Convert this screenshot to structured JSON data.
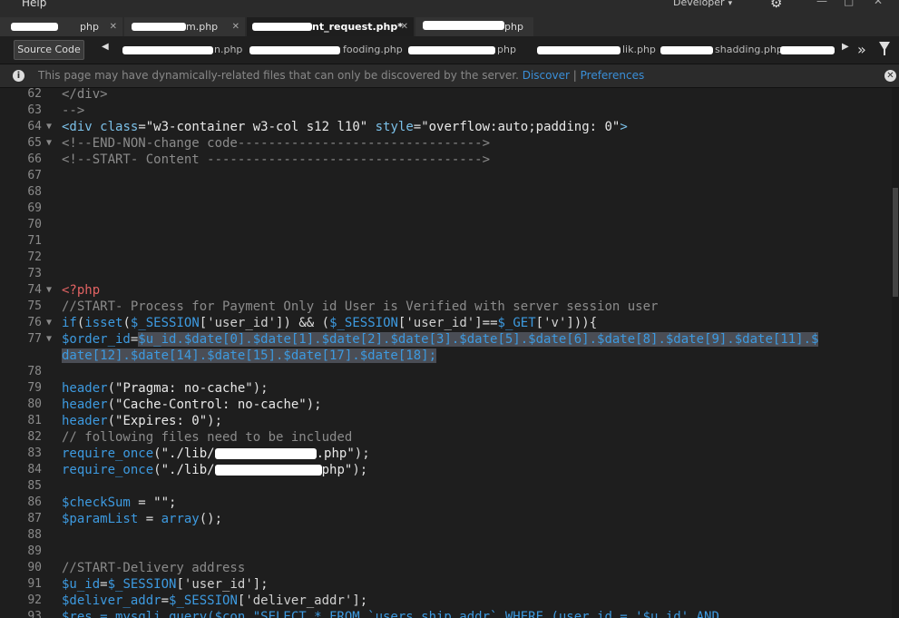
{
  "menu": {
    "help": "Help"
  },
  "workspace": {
    "label": "Developer"
  },
  "tabs": [
    {
      "label": "",
      "suffix": "php"
    },
    {
      "label": "",
      "suffix": "m.php"
    },
    {
      "label": "",
      "suffix": "nt_request.php*"
    },
    {
      "label": "",
      "suffix": "php"
    }
  ],
  "related": {
    "source_code": "Source Code",
    "files": [
      "n.php",
      "fooding.php",
      "php",
      "lik.php",
      "shadding.php",
      ""
    ]
  },
  "info": {
    "text": "This page may have dynamically-related files that can only be discovered by the server.",
    "discover": "Discover",
    "sep": "|",
    "preferences": "Preferences"
  },
  "code_lines": [
    {
      "n": "62",
      "fold": "",
      "parts": [
        {
          "t": "</div>",
          "c": "c-comm"
        }
      ]
    },
    {
      "n": "63",
      "fold": "",
      "parts": [
        {
          "t": "-->",
          "c": "c-comm"
        }
      ]
    },
    {
      "n": "64",
      "fold": "▼",
      "parts": [
        {
          "t": "<div ",
          "c": "c-tag"
        },
        {
          "t": "class",
          "c": "c-attr"
        },
        {
          "t": "=",
          "c": "c-pun"
        },
        {
          "t": "\"w3-container w3-col s12 l10\"",
          "c": "c-str"
        },
        {
          "t": " style",
          "c": "c-attr"
        },
        {
          "t": "=",
          "c": "c-pun"
        },
        {
          "t": "\"overflow:auto;padding: 0\"",
          "c": "c-str"
        },
        {
          "t": ">",
          "c": "c-tag"
        }
      ]
    },
    {
      "n": "65",
      "fold": "▼",
      "parts": [
        {
          "t": "<!--END-NON-change code-------------------------------->",
          "c": "c-comm"
        }
      ]
    },
    {
      "n": "66",
      "fold": "",
      "parts": [
        {
          "t": "<!--START- Content ------------------------------------>",
          "c": "c-comm"
        }
      ]
    },
    {
      "n": "67",
      "fold": "",
      "parts": []
    },
    {
      "n": "68",
      "fold": "",
      "parts": []
    },
    {
      "n": "69",
      "fold": "",
      "parts": []
    },
    {
      "n": "70",
      "fold": "",
      "parts": []
    },
    {
      "n": "71",
      "fold": "",
      "parts": []
    },
    {
      "n": "72",
      "fold": "",
      "parts": []
    },
    {
      "n": "73",
      "fold": "",
      "parts": []
    },
    {
      "n": "74",
      "fold": "▼",
      "parts": [
        {
          "t": "<?php",
          "c": "c-php"
        }
      ]
    },
    {
      "n": "75",
      "fold": "",
      "parts": [
        {
          "t": "//START- Process for Payment Only id User is Verified with server session user",
          "c": "c-comm"
        }
      ]
    },
    {
      "n": "76",
      "fold": "▼",
      "parts": [
        {
          "t": "if",
          "c": "c-func"
        },
        {
          "t": "(",
          "c": "c-pun"
        },
        {
          "t": "isset",
          "c": "c-func"
        },
        {
          "t": "(",
          "c": "c-pun"
        },
        {
          "t": "$_SESSION",
          "c": "c-var"
        },
        {
          "t": "[",
          "c": "c-pun"
        },
        {
          "t": "'user_id'",
          "c": "c-sstr"
        },
        {
          "t": "]) && (",
          "c": "c-pun"
        },
        {
          "t": "$_SESSION",
          "c": "c-var"
        },
        {
          "t": "[",
          "c": "c-pun"
        },
        {
          "t": "'user_id'",
          "c": "c-sstr"
        },
        {
          "t": "]==",
          "c": "c-pun"
        },
        {
          "t": "$_GET",
          "c": "c-var"
        },
        {
          "t": "[",
          "c": "c-pun"
        },
        {
          "t": "'v'",
          "c": "c-sstr"
        },
        {
          "t": "])){",
          "c": "c-pun"
        }
      ]
    },
    {
      "n": "77",
      "fold": "▼",
      "parts": [
        {
          "t": "$order_id",
          "c": "c-var"
        },
        {
          "t": "=",
          "c": "c-pun"
        },
        {
          "t": "$u_id.$date[0].$date[1].$date[2].$date[3].$date[5].$date[6].$date[8].$date[9].$date[11].$",
          "c": "c-var",
          "hl": true
        }
      ]
    },
    {
      "n": "",
      "fold": "",
      "parts": [
        {
          "t": "date[12].$date[14].$date[15].$date[17].$date[18];",
          "c": "c-var",
          "hl": true
        }
      ]
    },
    {
      "n": "78",
      "fold": "",
      "parts": []
    },
    {
      "n": "79",
      "fold": "",
      "parts": [
        {
          "t": "header",
          "c": "c-func"
        },
        {
          "t": "(",
          "c": "c-pun"
        },
        {
          "t": "\"Pragma: no-cache\"",
          "c": "c-str"
        },
        {
          "t": ");",
          "c": "c-pun"
        }
      ]
    },
    {
      "n": "80",
      "fold": "",
      "parts": [
        {
          "t": "header",
          "c": "c-func"
        },
        {
          "t": "(",
          "c": "c-pun"
        },
        {
          "t": "\"Cache-Control: no-cache\"",
          "c": "c-str"
        },
        {
          "t": ");",
          "c": "c-pun"
        }
      ]
    },
    {
      "n": "81",
      "fold": "",
      "parts": [
        {
          "t": "header",
          "c": "c-func"
        },
        {
          "t": "(",
          "c": "c-pun"
        },
        {
          "t": "\"Expires: 0\"",
          "c": "c-str"
        },
        {
          "t": ");",
          "c": "c-pun"
        }
      ]
    },
    {
      "n": "82",
      "fold": "",
      "parts": [
        {
          "t": "// following files need to be included",
          "c": "c-comm"
        }
      ]
    },
    {
      "n": "83",
      "fold": "",
      "parts": [
        {
          "t": "require_once",
          "c": "c-func"
        },
        {
          "t": "(",
          "c": "c-pun"
        },
        {
          "t": "\"./lib/",
          "c": "c-str"
        },
        {
          "t": "",
          "c": "redact",
          "w": 112
        },
        {
          "t": ".php\"",
          "c": "c-str"
        },
        {
          "t": ");",
          "c": "c-pun"
        }
      ]
    },
    {
      "n": "84",
      "fold": "",
      "parts": [
        {
          "t": "require_once",
          "c": "c-func"
        },
        {
          "t": "(",
          "c": "c-pun"
        },
        {
          "t": "\"./lib/",
          "c": "c-str"
        },
        {
          "t": "",
          "c": "redact",
          "w": 118
        },
        {
          "t": "php\"",
          "c": "c-str"
        },
        {
          "t": ");",
          "c": "c-pun"
        }
      ]
    },
    {
      "n": "85",
      "fold": "",
      "parts": []
    },
    {
      "n": "86",
      "fold": "",
      "parts": [
        {
          "t": "$checkSum",
          "c": "c-var"
        },
        {
          "t": " = ",
          "c": "c-pun"
        },
        {
          "t": "\"\"",
          "c": "c-str"
        },
        {
          "t": ";",
          "c": "c-pun"
        }
      ]
    },
    {
      "n": "87",
      "fold": "",
      "parts": [
        {
          "t": "$paramList",
          "c": "c-var"
        },
        {
          "t": " = ",
          "c": "c-pun"
        },
        {
          "t": "array",
          "c": "c-func"
        },
        {
          "t": "();",
          "c": "c-pun"
        }
      ]
    },
    {
      "n": "88",
      "fold": "",
      "parts": []
    },
    {
      "n": "89",
      "fold": "",
      "parts": []
    },
    {
      "n": "90",
      "fold": "",
      "parts": [
        {
          "t": "//START-Delivery address",
          "c": "c-comm"
        }
      ]
    },
    {
      "n": "91",
      "fold": "",
      "parts": [
        {
          "t": "$u_id",
          "c": "c-var"
        },
        {
          "t": "=",
          "c": "c-pun"
        },
        {
          "t": "$_SESSION",
          "c": "c-var"
        },
        {
          "t": "[",
          "c": "c-pun"
        },
        {
          "t": "'user_id'",
          "c": "c-sstr"
        },
        {
          "t": "];",
          "c": "c-pun"
        }
      ]
    },
    {
      "n": "92",
      "fold": "",
      "parts": [
        {
          "t": "$deliver_addr",
          "c": "c-var"
        },
        {
          "t": "=",
          "c": "c-pun"
        },
        {
          "t": "$_SESSION",
          "c": "c-var"
        },
        {
          "t": "[",
          "c": "c-pun"
        },
        {
          "t": "'deliver_addr'",
          "c": "c-sstr"
        },
        {
          "t": "];",
          "c": "c-pun"
        }
      ]
    },
    {
      "n": "93",
      "fold": "",
      "parts": [
        {
          "t": "$res = mysqli_query($con,\"SELECT * FROM `users_ship_addr` WHERE (user_id = '$u_id' AND",
          "c": "c-var"
        }
      ]
    }
  ]
}
